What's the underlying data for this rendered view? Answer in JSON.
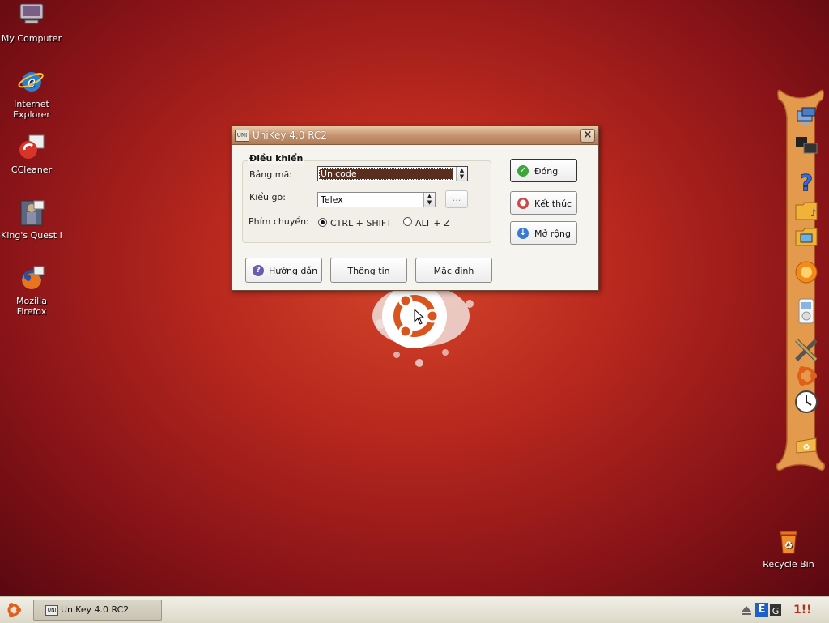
{
  "desktop": {
    "icons": [
      {
        "label": "My Computer",
        "icon": "my-computer-icon"
      },
      {
        "label": "Internet Explorer",
        "icon": "internet-explorer-icon"
      },
      {
        "label": "CCleaner",
        "icon": "ccleaner-icon"
      },
      {
        "label": "King's Quest I",
        "icon": "kings-quest-icon"
      },
      {
        "label": "Mozilla Firefox",
        "icon": "firefox-icon"
      }
    ],
    "recycle_bin": "Recycle Bin"
  },
  "dialog": {
    "title": "UniKey 4.0 RC2",
    "title_icon": "UNI",
    "close": "×",
    "group_label": "Điều khiển",
    "charset_label": "Bảng mã:",
    "charset_value": "Unicode",
    "input_method_label": "Kiểu gõ:",
    "input_method_value": "Telex",
    "more_button": "...",
    "switch_label": "Phím chuyển:",
    "switch_options": [
      "CTRL + SHIFT",
      "ALT + Z"
    ],
    "switch_selected": "CTRL + SHIFT",
    "buttons": {
      "close": "Đóng",
      "exit": "Kết thúc",
      "expand": "Mở rộng",
      "help": "Hướng dẫn",
      "info": "Thông tin",
      "default": "Mặc định"
    }
  },
  "taskbar": {
    "task_item": "UniKey 4.0 RC2",
    "task_item_icon": "UNI",
    "tray_ime": "E",
    "tray_clock": "1!!"
  },
  "colors": {
    "desktop_bg": "#b8281e",
    "titlebar": "#c69470",
    "dock": "#e49a4c",
    "selected_field": "#5a2e1e"
  }
}
